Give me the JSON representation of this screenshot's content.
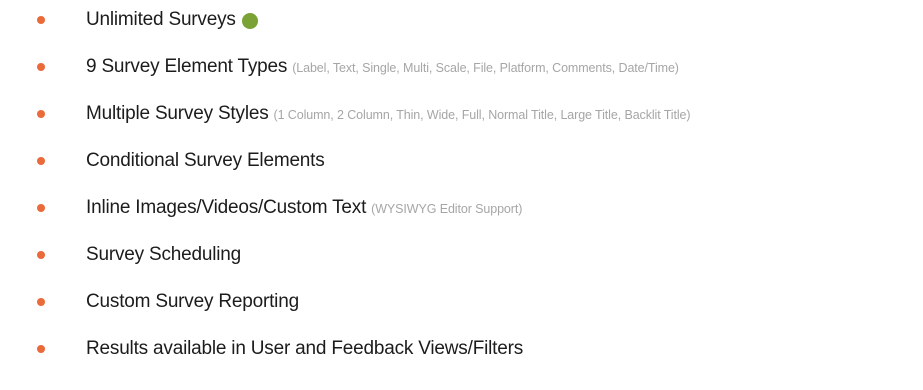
{
  "features": [
    {
      "label": "Unlimited Surveys",
      "detail": "",
      "status_dot": true
    },
    {
      "label": "9 Survey Element Types",
      "detail": "(Label, Text, Single, Multi, Scale, File, Platform, Comments, Date/Time)"
    },
    {
      "label": "Multiple Survey Styles",
      "detail": "(1 Column, 2 Column, Thin, Wide, Full, Normal Title, Large Title, Backlit Title)"
    },
    {
      "label": "Conditional Survey Elements",
      "detail": ""
    },
    {
      "label": "Inline Images/Videos/Custom Text",
      "detail": "(WYSIWYG Editor Support)"
    },
    {
      "label": "Survey Scheduling",
      "detail": ""
    },
    {
      "label": "Custom Survey Reporting",
      "detail": ""
    },
    {
      "label": "Results available in User and Feedback Views/Filters",
      "detail": ""
    }
  ],
  "colors": {
    "bullet": "#ea6a3a",
    "status_dot": "#7aa235",
    "main_text": "#1c1c1c",
    "detail_text": "#a6a6a6"
  },
  "icons": {
    "bullet": "bullet-icon",
    "status": "status-dot-icon"
  }
}
